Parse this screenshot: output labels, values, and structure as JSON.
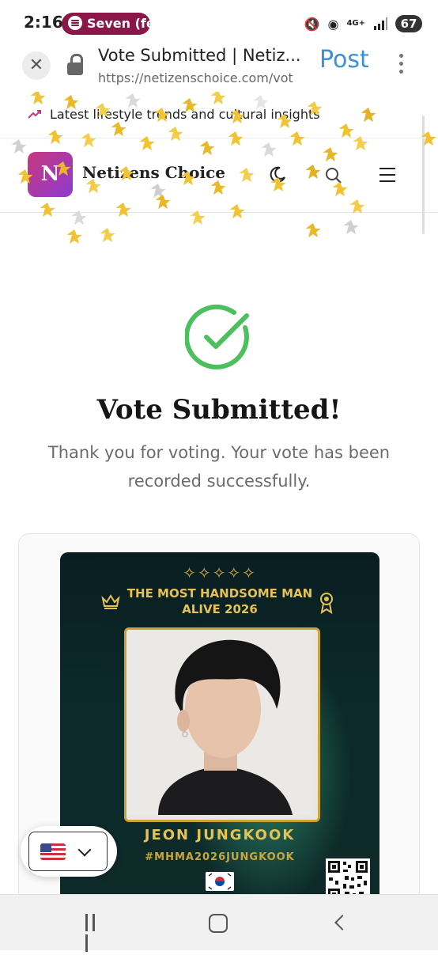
{
  "status_bar": {
    "time": "2:16",
    "media_label": "Seven (fe",
    "network_label": "4G+",
    "battery": "67"
  },
  "browser": {
    "page_title": "Vote Submitted | Netiz...",
    "url": "https://netizenschoice.com/vot",
    "post_label": "Post"
  },
  "site": {
    "ticker_text": "Latest lifestyle trends and cultural insights",
    "logo_letter": "N",
    "brand_name": "Netizens Choice"
  },
  "content": {
    "heading": "Vote Submitted!",
    "message": "Thank you for voting. Your vote has been recorded successfully."
  },
  "poster": {
    "sparkles": "✧✧✧✧✧",
    "title": "THE MOST HANDSOME MAN ALIVE 2026",
    "name": "JEON JUNGKOOK",
    "hashtag": "#MHMA2026JUNGKOOK"
  },
  "colors": {
    "accent_blue": "#3d8fd8",
    "success_green": "#4cbf5e",
    "gold": "#e6c255",
    "spotify_pill": "#8a1747"
  }
}
